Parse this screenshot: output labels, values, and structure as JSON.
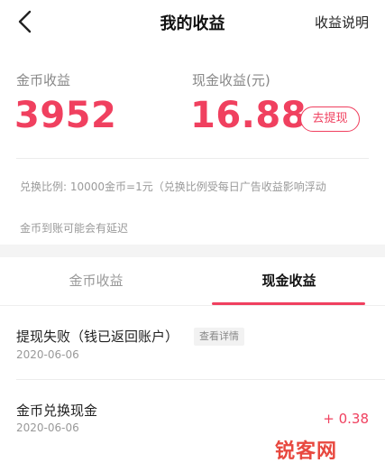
{
  "header": {
    "title": "我的收益",
    "link": "收益说明",
    "back_icon": "chevron-left-icon"
  },
  "earnings": {
    "coin_label": "金币收益",
    "coin_value": "3952",
    "cash_label": "现金收益(元)",
    "cash_value": "16.88",
    "withdraw_label": "去提现"
  },
  "notes": {
    "exchange_rate": "兑换比例: 10000金币=1元（兑换比例受每日广告收益影响浮动",
    "delay": "金币到账可能会有延迟"
  },
  "tabs": [
    {
      "label": "金币收益",
      "active": false
    },
    {
      "label": "现金收益",
      "active": true
    }
  ],
  "records": [
    {
      "title": "提现失败（钱已返回账户）",
      "date": "2020-06-06",
      "detail_label": "查看详情"
    },
    {
      "title": "金币兑换现金",
      "date": "2020-06-06",
      "amount": "+ 0.38"
    }
  ],
  "watermark": "锐客网",
  "colors": {
    "accent": "#f0405f",
    "muted": "#999999",
    "band": "#f4f4f4"
  }
}
